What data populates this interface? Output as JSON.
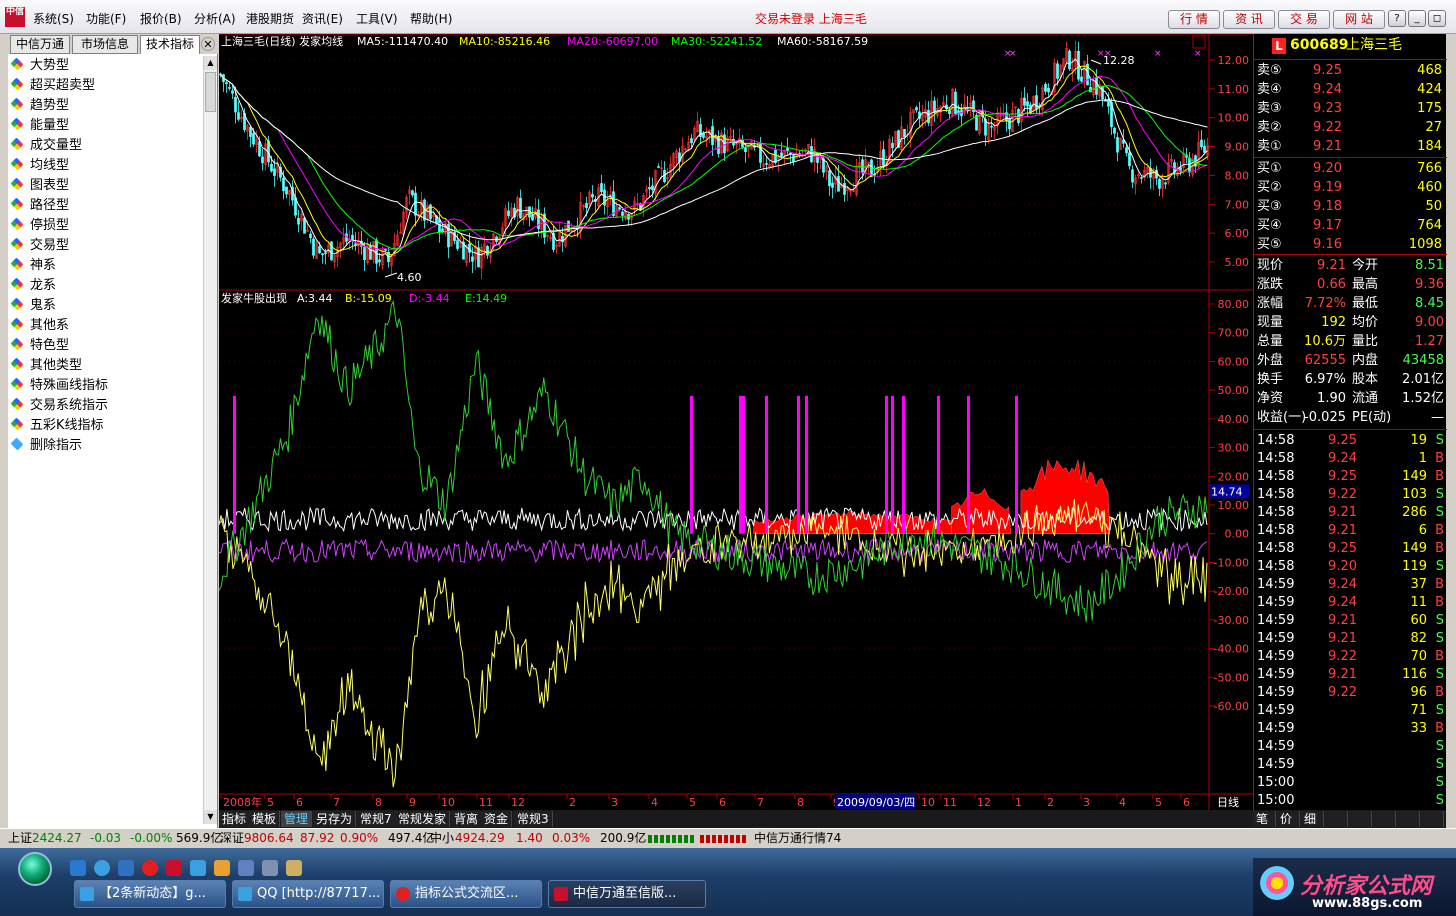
{
  "app": {
    "logo_text": "中信",
    "menus": [
      "系统(S)",
      "功能(F)",
      "报价(B)",
      "分析(A)",
      "港股期货",
      "资讯(E)",
      "工具(V)",
      "帮助(H)"
    ],
    "status_title": "交易未登录  上海三毛",
    "top_buttons": [
      "行 情",
      "资 讯",
      "交 易",
      "网 站"
    ],
    "window_controls": [
      "?",
      "_",
      "◻",
      "✕"
    ]
  },
  "left_panel": {
    "tabs": [
      "中信万通",
      "市场信息",
      "技术指标"
    ],
    "close": "✕",
    "items": [
      "大势型",
      "超买超卖型",
      "趋势型",
      "能量型",
      "成交量型",
      "均线型",
      "图表型",
      "路径型",
      "停损型",
      "交易型",
      "神系",
      "龙系",
      "鬼系",
      "其他系",
      "特色型",
      "其他类型",
      "特殊画线指标",
      "交易系统指示",
      "五彩K线指标",
      "删除指示"
    ]
  },
  "chart": {
    "main_header": {
      "title": "上海三毛(日线) 发家均线",
      "ma5": "MA5:-111470.40",
      "ma10": "MA10:-85216.46",
      "ma20": "MA20:-60697.00",
      "ma30": "MA30:-52241.52",
      "ma60": "MA60:-58167.59"
    },
    "price_axis": [
      "12.00",
      "11.00",
      "10.00",
      "9.00",
      "8.00",
      "7.00",
      "6.00",
      "5.00"
    ],
    "high_label": "12.28",
    "low_label": "4.60",
    "sub_header": {
      "title": "发家牛股出现",
      "a": "A:3.44",
      "b": "B:-15.09",
      "d": "D:-3.44",
      "e": "E:14.49"
    },
    "indicator_axis": [
      "80.00",
      "70.00",
      "60.00",
      "50.00",
      "40.00",
      "30.00",
      "20.00",
      "10.00",
      "0.00",
      "-10.00",
      "-20.00",
      "-30.00",
      "-40.00",
      "-50.00",
      "-60.00"
    ],
    "current_marker": "14.74",
    "date_axis": [
      "2008年",
      "5",
      "6",
      "7",
      "8",
      "9",
      "10",
      "11",
      "12",
      "2",
      "3",
      "4",
      "5",
      "6",
      "7",
      "8",
      "9",
      "10",
      "11",
      "12",
      "1",
      "2",
      "3",
      "4",
      "5",
      "6",
      "7"
    ],
    "cursor_date": "2009/09/03/四",
    "period": "日线",
    "colors": {
      "ma5": "#ffffff",
      "ma10": "#ffff00",
      "ma20": "#ff00ff",
      "ma30": "#00ff00",
      "ma60": "#ffffff",
      "up": "#ff3030",
      "down": "#54ffff",
      "signal": "#ff00ff"
    }
  },
  "quote_panel": {
    "badge": "L",
    "code": "600689",
    "name": "上海三毛",
    "sell": [
      {
        "label": "卖⑤",
        "price": "9.25",
        "vol": "468"
      },
      {
        "label": "卖④",
        "price": "9.24",
        "vol": "424"
      },
      {
        "label": "卖③",
        "price": "9.23",
        "vol": "175"
      },
      {
        "label": "卖②",
        "price": "9.22",
        "vol": "27"
      },
      {
        "label": "卖①",
        "price": "9.21",
        "vol": "184"
      }
    ],
    "buy": [
      {
        "label": "买①",
        "price": "9.20",
        "vol": "766"
      },
      {
        "label": "买②",
        "price": "9.19",
        "vol": "460"
      },
      {
        "label": "买③",
        "price": "9.18",
        "vol": "50"
      },
      {
        "label": "买④",
        "price": "9.17",
        "vol": "764"
      },
      {
        "label": "买⑤",
        "price": "9.16",
        "vol": "1098"
      }
    ],
    "stats": [
      {
        "l1": "现价",
        "v1": "9.21",
        "l2": "今开",
        "v2": "8.51",
        "c1": "#ff4040",
        "c2": "#40ff40"
      },
      {
        "l1": "涨跌",
        "v1": "0.66",
        "l2": "最高",
        "v2": "9.36",
        "c1": "#ff4040",
        "c2": "#ff4040"
      },
      {
        "l1": "涨幅",
        "v1": "7.72%",
        "l2": "最低",
        "v2": "8.45",
        "c1": "#ff4040",
        "c2": "#40ff40"
      },
      {
        "l1": "现量",
        "v1": "192",
        "l2": "均价",
        "v2": "9.00",
        "c1": "#ffff00",
        "c2": "#ff4040"
      },
      {
        "l1": "总量",
        "v1": "10.6万",
        "l2": "量比",
        "v2": "1.27",
        "c1": "#ffff00",
        "c2": "#ff4040"
      },
      {
        "l1": "外盘",
        "v1": "62555",
        "l2": "内盘",
        "v2": "43458",
        "c1": "#ff4040",
        "c2": "#40ff40"
      },
      {
        "l1": "换手",
        "v1": "6.97%",
        "l2": "股本",
        "v2": "2.01亿",
        "c1": "#ffffff",
        "c2": "#ffffff"
      },
      {
        "l1": "净资",
        "v1": "1.90",
        "l2": "流通",
        "v2": "1.52亿",
        "c1": "#ffffff",
        "c2": "#ffffff"
      },
      {
        "l1": "收益(一)",
        "v1": "-0.025",
        "l2": "PE(动)",
        "v2": "—",
        "c1": "#ffffff",
        "c2": "#ffffff"
      }
    ],
    "ticks": [
      {
        "t": "14:58",
        "p": "9.25",
        "v": "19",
        "s": "S"
      },
      {
        "t": "14:58",
        "p": "9.24",
        "v": "1",
        "s": "B"
      },
      {
        "t": "14:58",
        "p": "9.25",
        "v": "149",
        "s": "B"
      },
      {
        "t": "14:58",
        "p": "9.22",
        "v": "103",
        "s": "S"
      },
      {
        "t": "14:58",
        "p": "9.21",
        "v": "286",
        "s": "S"
      },
      {
        "t": "14:58",
        "p": "9.21",
        "v": "6",
        "s": "B"
      },
      {
        "t": "14:58",
        "p": "9.25",
        "v": "149",
        "s": "B"
      },
      {
        "t": "14:58",
        "p": "9.20",
        "v": "119",
        "s": "S"
      },
      {
        "t": "14:59",
        "p": "9.24",
        "v": "37",
        "s": "B"
      },
      {
        "t": "14:59",
        "p": "9.24",
        "v": "11",
        "s": "B"
      },
      {
        "t": "14:59",
        "p": "9.21",
        "v": "60",
        "s": "S"
      },
      {
        "t": "14:59",
        "p": "9.21",
        "v": "82",
        "s": "S"
      },
      {
        "t": "14:59",
        "p": "9.22",
        "v": "70",
        "s": "B"
      },
      {
        "t": "14:59",
        "p": "9.21",
        "v": "116",
        "s": "S"
      },
      {
        "t": "14:59",
        "p": "9.22",
        "v": "96",
        "s": "B"
      },
      {
        "t": "14:59",
        "p": "",
        "v": "71",
        "s": "S"
      },
      {
        "t": "14:59",
        "p": "",
        "v": "33",
        "s": "B"
      },
      {
        "t": "14:59",
        "p": "",
        "v": "",
        "s": "S"
      },
      {
        "t": "14:59",
        "p": "",
        "v": "",
        "s": "S"
      },
      {
        "t": "15:00",
        "p": "",
        "v": "",
        "s": "S"
      },
      {
        "t": "15:00",
        "p": "",
        "v": "",
        "s": "S"
      }
    ],
    "bottom_tabs": [
      "笔",
      "价",
      "细",
      "",
      "",
      "",
      "",
      ""
    ]
  },
  "bottom_tabs": [
    "指标",
    "模板",
    "管理",
    "另存为",
    "常规7",
    "常规发家",
    "背离",
    "资金",
    "常规3"
  ],
  "statusbar": {
    "sh_label": "上证",
    "sh_value": "2424.27",
    "sh_change": "-0.03",
    "sh_pct": "-0.00%",
    "sh_amount": "569.9亿",
    "sz_label": "深证",
    "sz_value": "9806.64",
    "sz_change": "87.92",
    "sz_pct": "0.90%",
    "sz_amount": "497.4亿",
    "zx_label": "中小",
    "zx_value": "4924.29",
    "zx_change": "1.40",
    "zx_pct": "0.03%",
    "zx_amount": "200.9亿",
    "feed": "中信万通行情74"
  },
  "taskbar": {
    "tasks": [
      "【2条新动态】g...",
      "QQ [http://87717...",
      "指标公式交流区...",
      "中信万通至信版..."
    ],
    "watermark_title": "分析家公式网",
    "watermark_url": "www.88gs.com"
  }
}
